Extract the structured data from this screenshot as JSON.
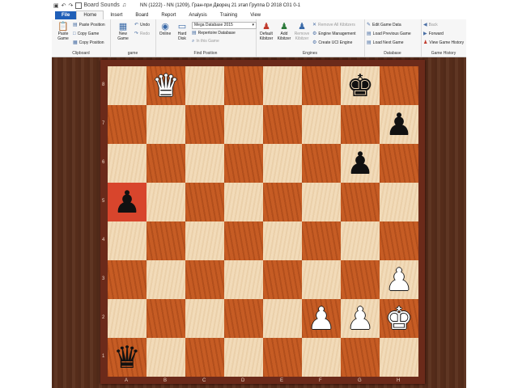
{
  "window": {
    "title": "NN (1222) - NN (1209), Гран-при Дворец 21 этап Группа D 2018  C01  0-1",
    "quick_access": {
      "board_sounds": "Board Sounds"
    }
  },
  "tabs": [
    "File",
    "Home",
    "Insert",
    "Board",
    "Report",
    "Analysis",
    "Training",
    "View"
  ],
  "ribbon": {
    "clipboard": {
      "label": "Clipboard",
      "paste_game": "Paste Game",
      "paste_position": "Paste Position",
      "copy_game": "Copy Game",
      "copy_position": "Copy Position"
    },
    "game": {
      "label": "game",
      "new_game": "New Game",
      "undo": "Undo",
      "redo": "Redo"
    },
    "find_position": {
      "label": "Find Position",
      "online": "Online",
      "hard_disk": "Hard Disk",
      "database": "Mega Database 2015",
      "repertoire": "Repertoire Database",
      "in_this_game": "In this Game"
    },
    "engines": {
      "label": "Engines",
      "default_kibitzer": "Default Kibitzer",
      "add_kibitzer": "Add Kibitzer",
      "remove_kibitzer": "Remove Kibitzer",
      "remove_all": "Remove All Kibitzers",
      "engine_management": "Engine Management",
      "create_uci": "Create UCI Engine"
    },
    "database": {
      "label": "Database",
      "edit_game_data": "Edit Game Data",
      "load_previous": "Load Previous Game",
      "load_next": "Load Next Game"
    },
    "game_history": {
      "label": "Game History",
      "back": "Back",
      "forward": "Forward",
      "view_history": "View Game History"
    }
  },
  "board": {
    "files": [
      "A",
      "B",
      "C",
      "D",
      "E",
      "F",
      "G",
      "H"
    ],
    "ranks": [
      "8",
      "7",
      "6",
      "5",
      "4",
      "3",
      "2",
      "1"
    ],
    "highlight_square": "a5",
    "pieces": [
      {
        "square": "b8",
        "glyph": "♛",
        "color": "white",
        "name": "white-queen"
      },
      {
        "square": "g8",
        "glyph": "♚",
        "color": "black",
        "name": "black-king"
      },
      {
        "square": "h7",
        "glyph": "♟",
        "color": "black",
        "name": "black-pawn"
      },
      {
        "square": "g6",
        "glyph": "♟",
        "color": "black",
        "name": "black-pawn"
      },
      {
        "square": "a5",
        "glyph": "♟",
        "color": "black",
        "name": "black-pawn"
      },
      {
        "square": "h3",
        "glyph": "♟",
        "color": "white",
        "name": "white-pawn"
      },
      {
        "square": "f2",
        "glyph": "♟",
        "color": "white",
        "name": "white-pawn"
      },
      {
        "square": "g2",
        "glyph": "♟",
        "color": "white",
        "name": "white-pawn"
      },
      {
        "square": "h2",
        "glyph": "♚",
        "color": "white",
        "name": "white-king"
      },
      {
        "square": "a1",
        "glyph": "♛",
        "color": "black",
        "name": "black-queen"
      }
    ]
  },
  "colors": {
    "light_square": "#f1d9b5",
    "dark_square": "#c35a22",
    "highlight": "#d8452c",
    "frame": "#6b2a1a"
  }
}
